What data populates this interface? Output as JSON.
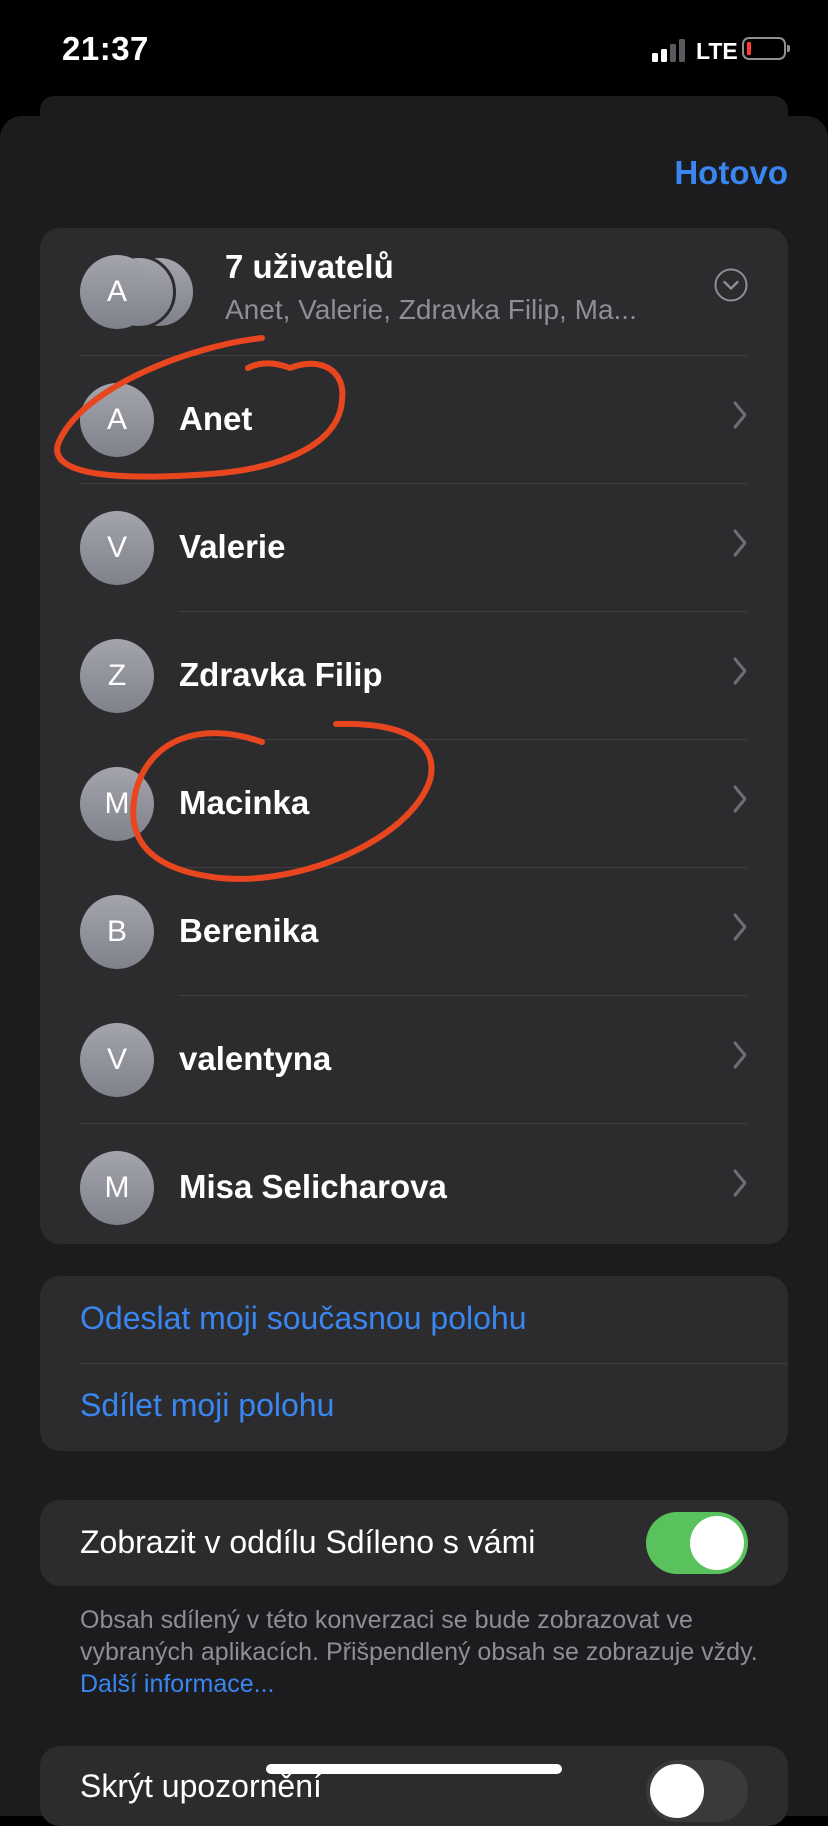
{
  "status_bar": {
    "time": "21:37",
    "network": "LTE"
  },
  "header": {
    "done_label": "Hotovo"
  },
  "group": {
    "avatar_letter": "A",
    "title": "7 uživatelů",
    "subtitle": "Anet, Valerie, Zdravka Filip, Ma..."
  },
  "members": [
    {
      "letter": "A",
      "name": "Anet"
    },
    {
      "letter": "V",
      "name": "Valerie"
    },
    {
      "letter": "Z",
      "name": "Zdravka Filip"
    },
    {
      "letter": "M",
      "name": "Macinka"
    },
    {
      "letter": "B",
      "name": "Berenika"
    },
    {
      "letter": "V",
      "name": "valentyna"
    },
    {
      "letter": "M",
      "name": "Misa Selicharova"
    }
  ],
  "actions": {
    "send_location": "Odeslat moji současnou polohu",
    "share_location": "Sdílet moji polohu"
  },
  "shared_with_you": {
    "label": "Zobrazit v oddílu Sdíleno s vámi",
    "enabled": true,
    "footnote": "Obsah sdílený v této konverzaci se bude zobrazovat ve vybraných aplikacích. Přišpendlený obsah se zobrazuje vždy.",
    "more_link": "Další informace..."
  },
  "hide_alerts": {
    "label": "Skrýt upozornění",
    "enabled": false
  },
  "colors": {
    "accent": "#3a86f0",
    "toggle_on": "#5ac25d",
    "annotation": "#e8461e"
  }
}
